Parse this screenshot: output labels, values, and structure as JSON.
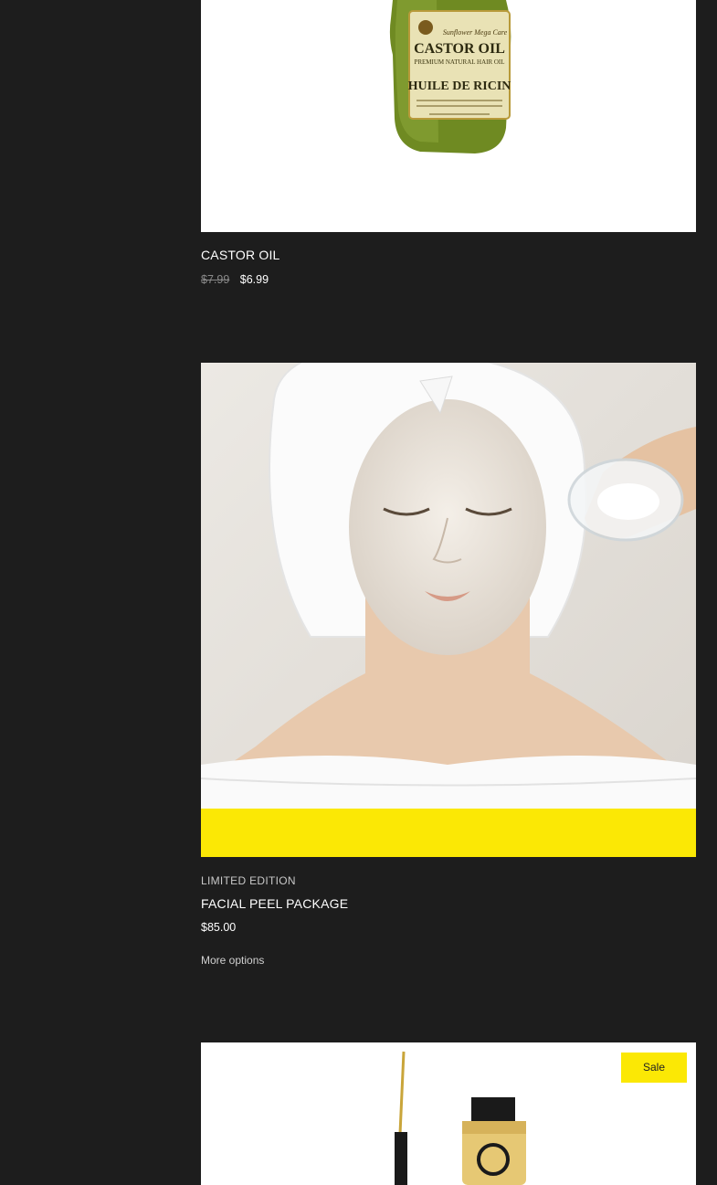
{
  "colors": {
    "background": "#1d1d1d",
    "text": "#ffffff",
    "muted_text": "#8a8a8a",
    "badge": "#fbe805"
  },
  "products": [
    {
      "image_alt": "Castor oil bottle",
      "image_label": {
        "brand": "Sunflower Mega Care",
        "name": "CASTOR OIL",
        "sub": "PREMIUM NATURAL HAIR OIL",
        "name_fr": "HUILE DE RICIN"
      },
      "title": "CASTOR OIL",
      "compare_price": "$7.99",
      "price": "$6.99"
    },
    {
      "image_alt": "Woman with facial peel mask",
      "tag": "LIMITED EDITION",
      "title": "FACIAL PEEL PACKAGE",
      "price": "$85.00",
      "more_options": "More options"
    },
    {
      "image_alt": "Eyeliner product",
      "badge": "Sale"
    }
  ]
}
